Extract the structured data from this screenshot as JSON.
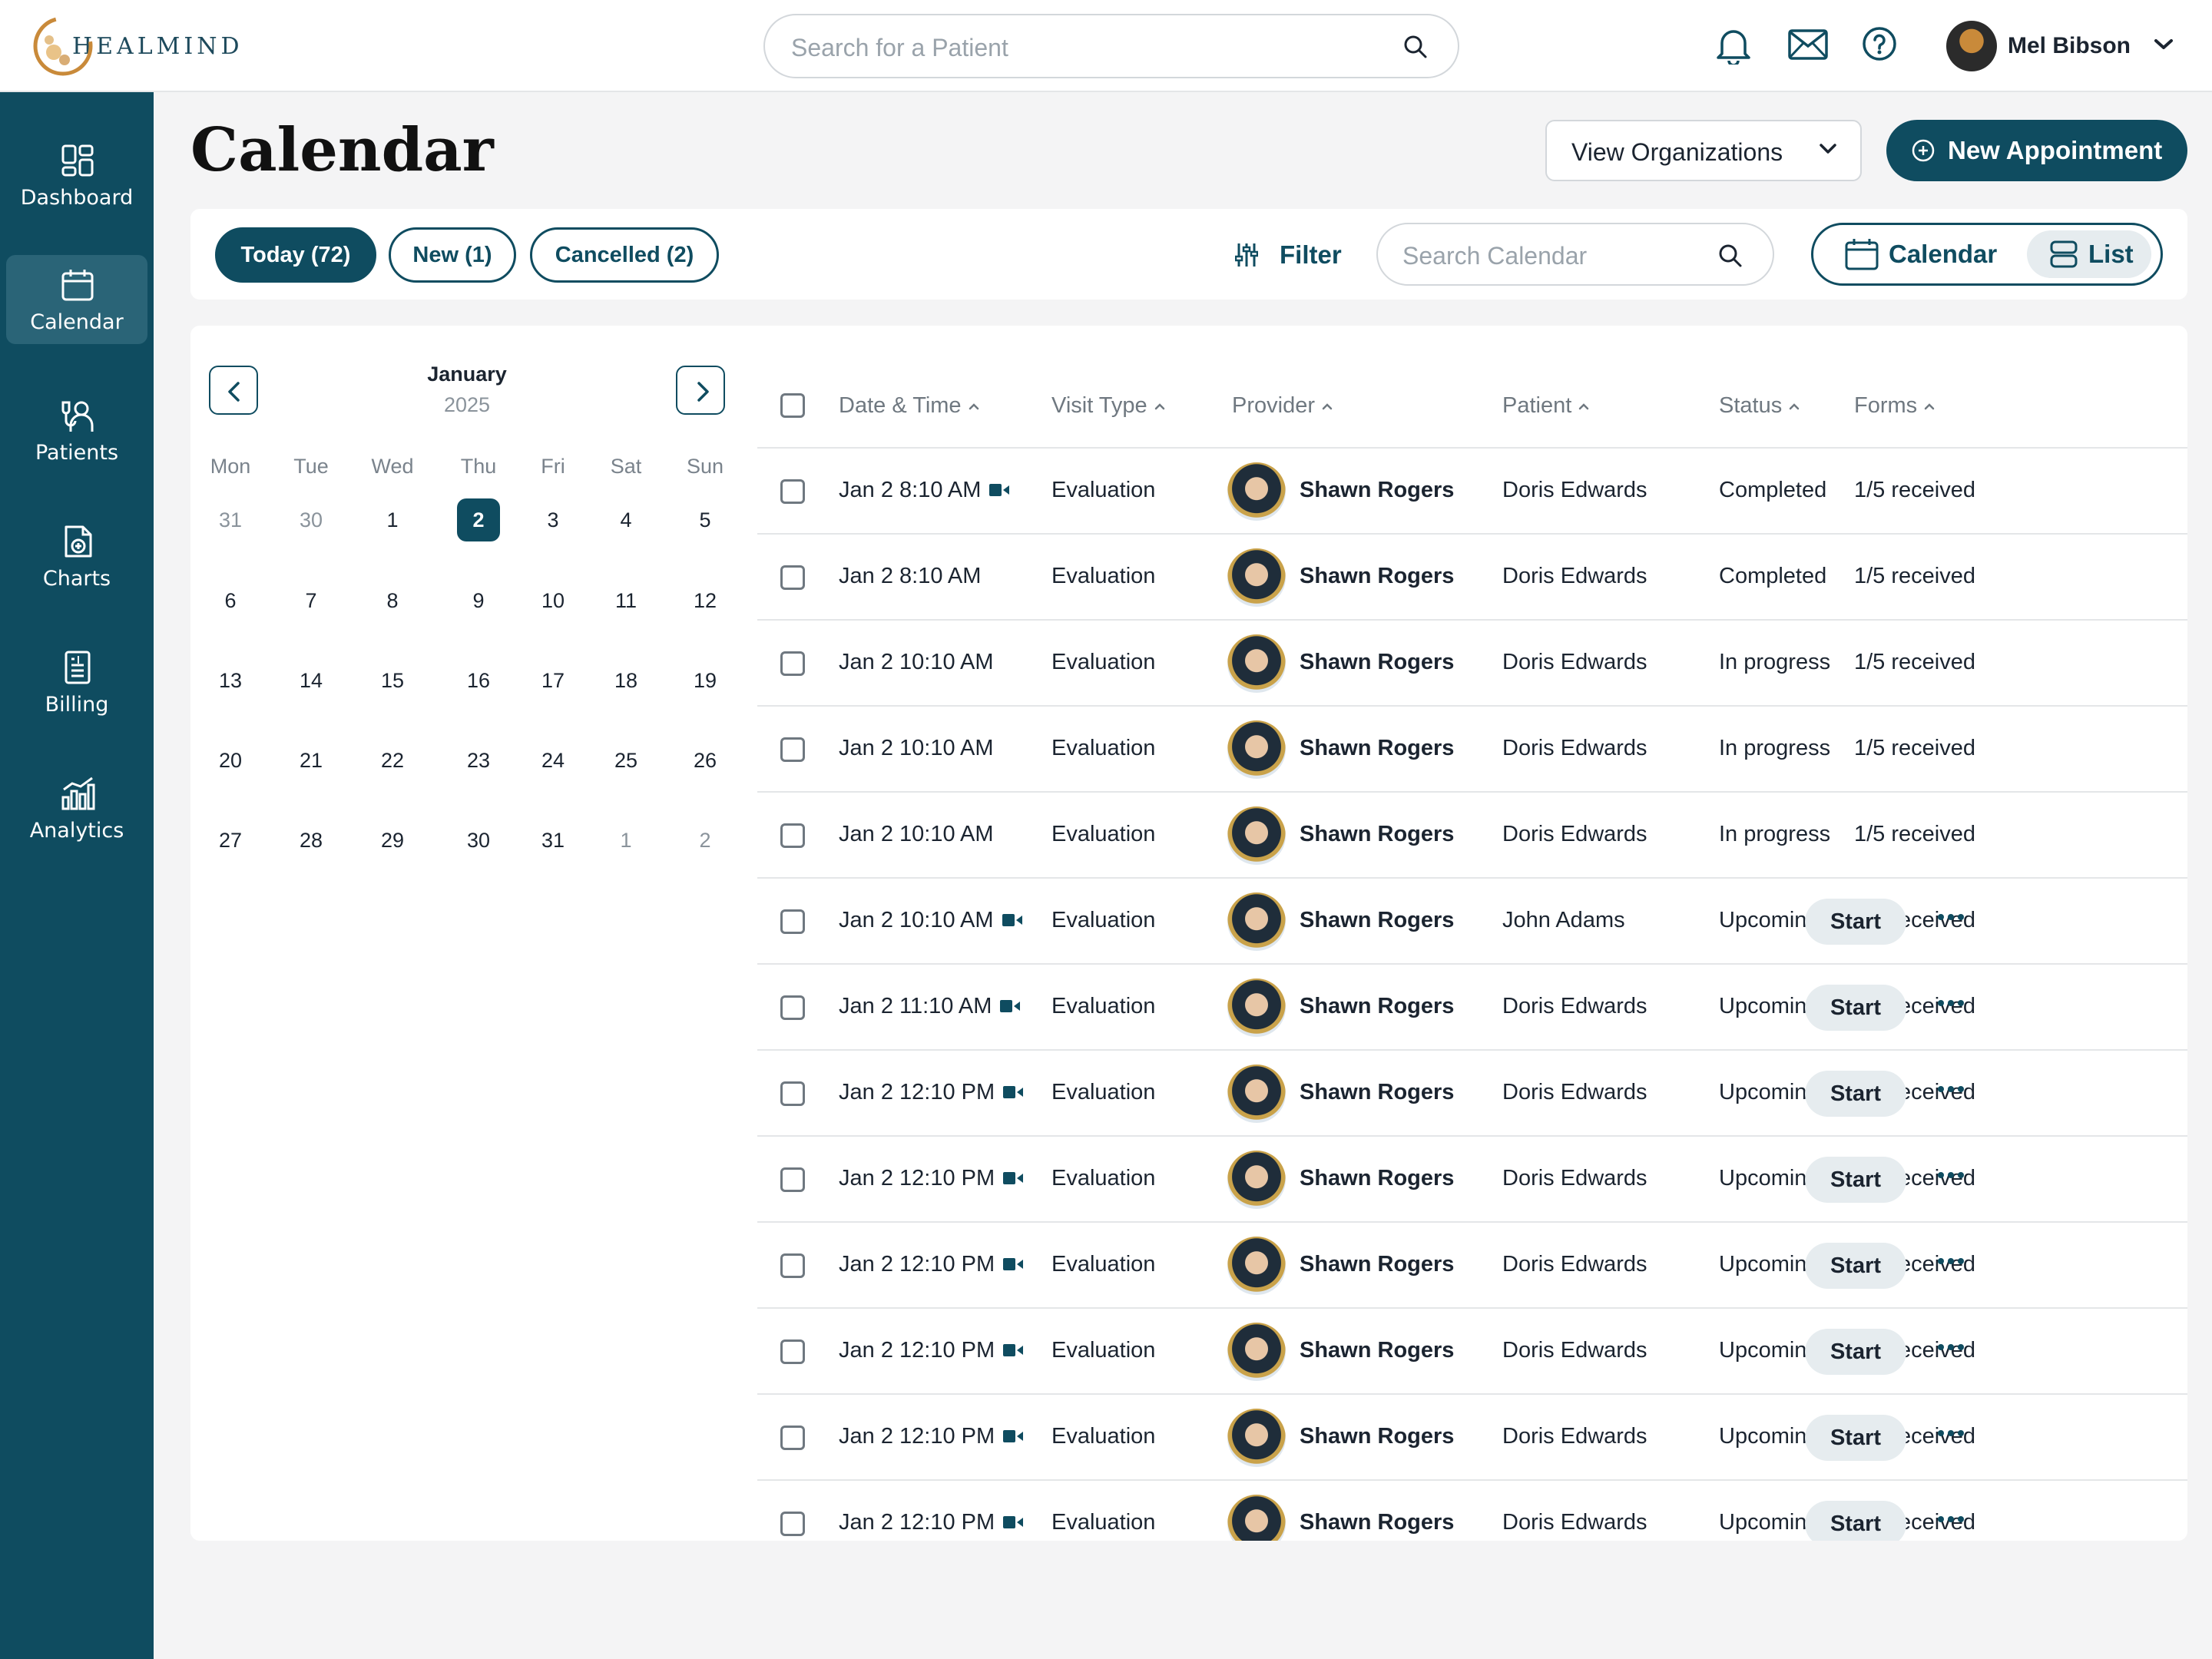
{
  "brand": {
    "name": "HEALMIND",
    "accent": "#0f4c60",
    "gold": "#c98a3a"
  },
  "header": {
    "search_placeholder": "Search for a Patient",
    "user_name": "Mel Bibson"
  },
  "sidebar": {
    "items": [
      {
        "label": "Dashboard",
        "icon": "dashboard-icon"
      },
      {
        "label": "Calendar",
        "icon": "calendar-icon",
        "active": true
      },
      {
        "label": "Patients",
        "icon": "patients-icon"
      },
      {
        "label": "Charts",
        "icon": "charts-icon"
      },
      {
        "label": "Billing",
        "icon": "billing-icon"
      },
      {
        "label": "Analytics",
        "icon": "analytics-icon"
      }
    ]
  },
  "page": {
    "title": "Calendar",
    "view_orgs": "View Organizations",
    "new_appt": "New Appointment"
  },
  "toolbar": {
    "tabs": [
      {
        "label": "Today (72)",
        "active": true
      },
      {
        "label": "New (1)"
      },
      {
        "label": "Cancelled (2)"
      }
    ],
    "filter_label": "Filter",
    "search_placeholder": "Search Calendar",
    "view_calendar": "Calendar",
    "view_list": "List"
  },
  "minical": {
    "month": "January",
    "year": "2025",
    "dow": [
      "Mon",
      "Tue",
      "Wed",
      "Thu",
      "Fri",
      "Sat",
      "Sun"
    ],
    "weeks": [
      [
        "31",
        "30",
        "1",
        "2",
        "3",
        "4",
        "5"
      ],
      [
        "6",
        "7",
        "8",
        "9",
        "10",
        "11",
        "12"
      ],
      [
        "13",
        "14",
        "15",
        "16",
        "17",
        "18",
        "19"
      ],
      [
        "20",
        "21",
        "22",
        "23",
        "24",
        "25",
        "26"
      ],
      [
        "27",
        "28",
        "29",
        "30",
        "31",
        "1",
        "2"
      ]
    ],
    "selected": "2"
  },
  "table": {
    "columns": [
      "Date & Time",
      "Visit Type",
      "Provider",
      "Patient",
      "Status",
      "Forms"
    ],
    "start_label": "Start",
    "rows": [
      {
        "date": "Jan 2",
        "time": "8:10 AM",
        "video": true,
        "visit": "Evaluation",
        "provider": "Shawn Rogers",
        "patient": "Doris Edwards",
        "status": "Completed",
        "forms": "1/5 received",
        "action": false
      },
      {
        "date": "Jan 2",
        "time": "8:10 AM",
        "video": false,
        "visit": "Evaluation",
        "provider": "Shawn Rogers",
        "patient": "Doris Edwards",
        "status": "Completed",
        "forms": "1/5 received",
        "action": false
      },
      {
        "date": "Jan 2",
        "time": "10:10 AM",
        "video": false,
        "visit": "Evaluation",
        "provider": "Shawn Rogers",
        "patient": "Doris Edwards",
        "status": "In progress",
        "forms": "1/5 received",
        "action": false
      },
      {
        "date": "Jan 2",
        "time": "10:10 AM",
        "video": false,
        "visit": "Evaluation",
        "provider": "Shawn Rogers",
        "patient": "Doris Edwards",
        "status": "In progress",
        "forms": "1/5 received",
        "action": false
      },
      {
        "date": "Jan 2",
        "time": "10:10 AM",
        "video": false,
        "visit": "Evaluation",
        "provider": "Shawn Rogers",
        "patient": "Doris Edwards",
        "status": "In progress",
        "forms": "1/5 received",
        "action": false
      },
      {
        "date": "Jan 2",
        "time": "10:10 AM",
        "video": true,
        "visit": "Evaluation",
        "provider": "Shawn Rogers",
        "patient": "John Adams",
        "status": "Upcoming",
        "forms": "1/5 received",
        "action": true
      },
      {
        "date": "Jan 2",
        "time": "11:10 AM",
        "video": true,
        "visit": "Evaluation",
        "provider": "Shawn Rogers",
        "patient": "Doris Edwards",
        "status": "Upcoming",
        "forms": "1/5 received",
        "action": true
      },
      {
        "date": "Jan 2",
        "time": "12:10 PM",
        "video": true,
        "visit": "Evaluation",
        "provider": "Shawn Rogers",
        "patient": "Doris Edwards",
        "status": "Upcoming",
        "forms": "1/5 received",
        "action": true
      },
      {
        "date": "Jan 2",
        "time": "12:10 PM",
        "video": true,
        "visit": "Evaluation",
        "provider": "Shawn Rogers",
        "patient": "Doris Edwards",
        "status": "Upcoming",
        "forms": "1/5 received",
        "action": true
      },
      {
        "date": "Jan 2",
        "time": "12:10 PM",
        "video": true,
        "visit": "Evaluation",
        "provider": "Shawn Rogers",
        "patient": "Doris Edwards",
        "status": "Upcoming",
        "forms": "1/5 received",
        "action": true
      },
      {
        "date": "Jan 2",
        "time": "12:10 PM",
        "video": true,
        "visit": "Evaluation",
        "provider": "Shawn Rogers",
        "patient": "Doris Edwards",
        "status": "Upcoming",
        "forms": "1/5 received",
        "action": true
      },
      {
        "date": "Jan 2",
        "time": "12:10 PM",
        "video": true,
        "visit": "Evaluation",
        "provider": "Shawn Rogers",
        "patient": "Doris Edwards",
        "status": "Upcoming",
        "forms": "1/5 received",
        "action": true
      },
      {
        "date": "Jan 2",
        "time": "12:10 PM",
        "video": true,
        "visit": "Evaluation",
        "provider": "Shawn Rogers",
        "patient": "Doris Edwards",
        "status": "Upcoming",
        "forms": "1/5 received",
        "action": true
      }
    ]
  }
}
